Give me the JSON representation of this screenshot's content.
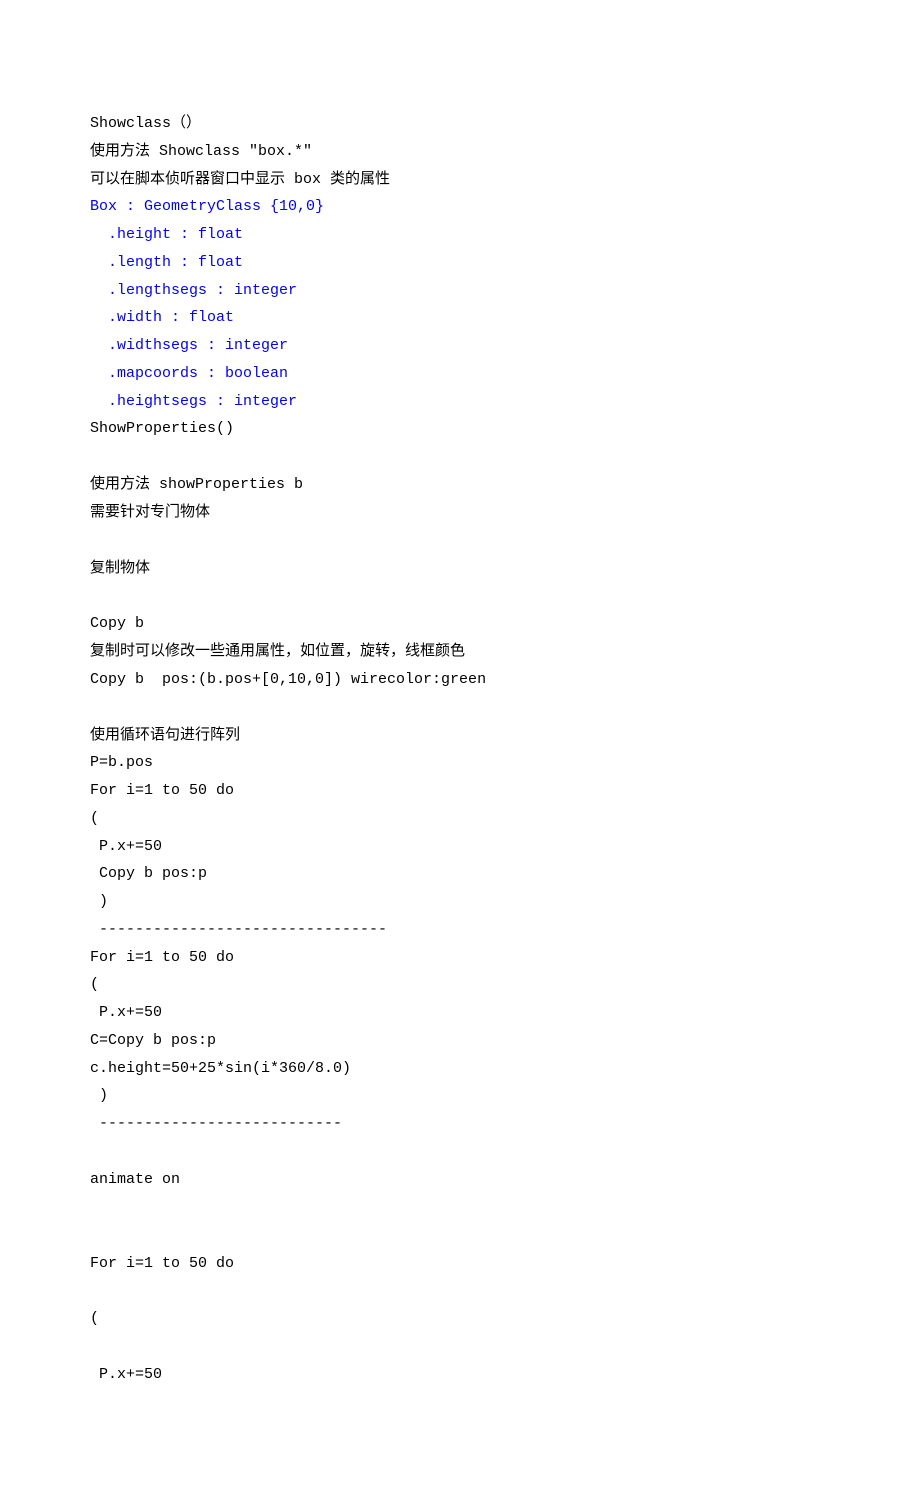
{
  "lines": {
    "l1": "Showclass（）",
    "l2": "使用方法 Showclass \"box.*\"",
    "l3a": "可以在脚本侦听器窗口中显示 ",
    "l3b": "box",
    "l3c": " 类的属性",
    "b1": "Box : GeometryClass {10,0}",
    "b2": ".height : float",
    "b3": ".length : float",
    "b4": ".lengthsegs : integer",
    "b5": ".width : float",
    "b6": ".widthsegs : integer",
    "b7": ".mapcoords : boolean",
    "b8": ".heightsegs : integer",
    "l4": "ShowProperties()",
    "l5": "使用方法 showProperties b",
    "l6": "需要针对专门物体",
    "l7": "复制物体",
    "l8": "Copy b",
    "l9": "复制时可以修改一些通用属性，如位置，旋转，线框颜色",
    "l10": "Copy b  pos:(b.pos+[0,10,0]) wirecolor:green",
    "l11": "使用循环语句进行阵列",
    "l12": "P=b.pos",
    "l13": "For i=1 to 50 do",
    "l14": "(",
    "l15": " P.x+=50",
    "l16": " Copy b pos:p",
    "l17": " )",
    "l18": " --------------------------------",
    "l19": "For i=1 to 50 do",
    "l20": "(",
    "l21": " P.x+=50",
    "l22": "C=Copy b pos:p",
    "l23": "c.height=50+25*sin(i*360/8.0)",
    "l24": " )",
    "l25": " ---------------------------",
    "l26": "animate on",
    "l27": "For i=1 to 50 do",
    "l28": "(",
    "l29": " P.x+=50"
  }
}
